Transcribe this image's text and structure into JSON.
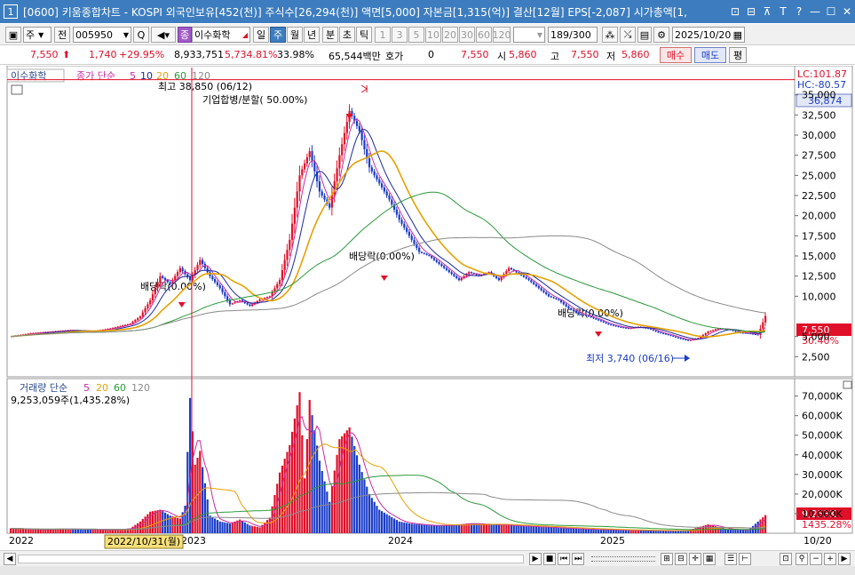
{
  "window": {
    "number": "1",
    "title": "[0600] 키움종합차트 - KOSPI 외국인보유[452(천)] 주식수[26,294(천)] 액면[5,000] 자본금[1,315(억)] 결산[12월] EPS[-2,087] 시가총액[1,",
    "icons": [
      "restore-icon",
      "tile-icon",
      "pin-icon",
      "text-icon",
      "help-icon",
      "minimize-icon",
      "maximize-icon",
      "close-icon"
    ],
    "icon_glyphs": [
      "⊡",
      "⊟",
      "⊼",
      "T",
      "?",
      "—",
      "☐",
      "✕"
    ]
  },
  "toolbar": {
    "period_select": "주",
    "prev_label": "전",
    "code": "005950",
    "search_glyph": "Q",
    "stock_badge": "종",
    "stock_name": "이수화학",
    "periods": [
      "일",
      "주",
      "월",
      "년",
      "분",
      "초",
      "틱"
    ],
    "active_period": "주",
    "intervals": [
      "1",
      "3",
      "5",
      "10",
      "20",
      "30",
      "60",
      "120"
    ],
    "count": "189",
    "count_total": "/300",
    "date": "2025/10/20"
  },
  "info": {
    "price": "7,550",
    "change": "1,740",
    "change_pct": "+29.95%",
    "volume": "8,933,751",
    "vol_pct": "5,734.81%",
    "turnover": "33.98%",
    "amount": "65,544백만",
    "bid_label": "호가",
    "bid_value": "0",
    "ask_price": "7,550",
    "open_label": "시",
    "open_value": "5,860",
    "high_label": "고",
    "high_value": "7,550",
    "low_label": "저",
    "low_value": "5,860",
    "buy_label": "매수",
    "sell_label": "매도",
    "flat_label": "평"
  },
  "price_panel": {
    "tag": "이수화학",
    "ma_title": "종가 단순",
    "ma_periods": [
      "5",
      "10",
      "20",
      "60",
      "120"
    ],
    "lc_label": "LC:101.87",
    "hc_label": "HC:-80.57",
    "top_value": "36,874",
    "current_label": "7,550",
    "current_pct": "30.40%",
    "high_annot": "최고 38,850 (06/12)",
    "merge_annot": "기업합병/분할( 50.00%)",
    "div_annot_1": "배당락(0.00%)",
    "div_annot_2": "배당락(0.00%)",
    "div_annot_3": "배당락(0.00%)",
    "low_annot": "최저 3,740 (06/16)",
    "y_ticks": [
      "35,000",
      "32,500",
      "30,000",
      "27,500",
      "25,000",
      "22,500",
      "20,000",
      "17,500",
      "15,000",
      "12,500",
      "10,000",
      "5,000",
      "2,500"
    ]
  },
  "volume_panel": {
    "title": "거래량 단순",
    "ma_periods": [
      "5",
      "20",
      "60",
      "120"
    ],
    "last_volume": "9,253,059주(1,435.28%)",
    "current_label": "9,253K",
    "current_pct": "1435.28%",
    "y_ticks": [
      "70,000K",
      "60,000K",
      "50,000K",
      "40,000K",
      "30,000K",
      "20,000K",
      "10,000K"
    ]
  },
  "x_axis": {
    "labels": [
      "2022",
      "2023",
      "2024",
      "2025"
    ],
    "cursor_label": "2022/10/31(월)",
    "right_label": "10/20"
  },
  "colors": {
    "up": "#e0102a",
    "down": "#1a3cc8",
    "ma5": "#cc2aa0",
    "ma10": "#1a2a9c",
    "ma20": "#e8a000",
    "ma60": "#2a9a3a",
    "ma120": "#8a8a8a",
    "titlebar": "#3d7dbf"
  },
  "chart_data": {
    "type": "candlestick",
    "interval": "weekly",
    "price_ylim": [
      0,
      37500
    ],
    "volume_ylim": [
      0,
      78000
    ],
    "volume_unit": "K",
    "moving_averages": [
      "5",
      "10",
      "20",
      "60",
      "120"
    ],
    "series": [
      {
        "name": "종가",
        "points": [
          [
            0,
            5000
          ],
          [
            8,
            5400
          ],
          [
            16,
            5600
          ],
          [
            24,
            5800
          ],
          [
            32,
            5600
          ],
          [
            40,
            6000
          ],
          [
            48,
            6600
          ],
          [
            52,
            7500
          ],
          [
            56,
            9500
          ],
          [
            60,
            12500
          ],
          [
            64,
            11500
          ],
          [
            68,
            13500
          ],
          [
            72,
            12000
          ],
          [
            76,
            14500
          ],
          [
            80,
            12500
          ],
          [
            84,
            11000
          ],
          [
            88,
            9000
          ],
          [
            92,
            9500
          ],
          [
            96,
            8800
          ],
          [
            100,
            9600
          ],
          [
            104,
            10000
          ],
          [
            108,
            12000
          ],
          [
            112,
            17000
          ],
          [
            116,
            25000
          ],
          [
            120,
            28000
          ],
          [
            124,
            23000
          ],
          [
            128,
            21000
          ],
          [
            132,
            27500
          ],
          [
            136,
            33000
          ],
          [
            140,
            30500
          ],
          [
            144,
            26000
          ],
          [
            148,
            24000
          ],
          [
            152,
            22000
          ],
          [
            156,
            19500
          ],
          [
            160,
            17500
          ],
          [
            164,
            15500
          ],
          [
            168,
            15000
          ],
          [
            172,
            14000
          ],
          [
            176,
            13000
          ],
          [
            180,
            12000
          ],
          [
            184,
            13000
          ],
          [
            188,
            12500
          ],
          [
            192,
            13000
          ],
          [
            196,
            12000
          ],
          [
            200,
            13500
          ],
          [
            204,
            12800
          ],
          [
            208,
            12000
          ],
          [
            212,
            11000
          ],
          [
            216,
            10000
          ],
          [
            220,
            9500
          ],
          [
            224,
            8500
          ],
          [
            228,
            7800
          ],
          [
            232,
            7500
          ],
          [
            236,
            7000
          ],
          [
            240,
            6500
          ],
          [
            244,
            6200
          ],
          [
            248,
            6000
          ],
          [
            252,
            6200
          ],
          [
            256,
            6000
          ],
          [
            260,
            5500
          ],
          [
            264,
            5200
          ],
          [
            268,
            4800
          ],
          [
            272,
            4500
          ],
          [
            276,
            4800
          ],
          [
            280,
            5600
          ],
          [
            284,
            6000
          ],
          [
            288,
            5900
          ],
          [
            292,
            5500
          ],
          [
            296,
            5400
          ],
          [
            300,
            5200
          ],
          [
            303,
            7550
          ]
        ]
      },
      {
        "name": "거래량",
        "points": [
          [
            0,
            2500
          ],
          [
            10,
            1800
          ],
          [
            20,
            2200
          ],
          [
            30,
            2000
          ],
          [
            40,
            1500
          ],
          [
            48,
            2500
          ],
          [
            52,
            6000
          ],
          [
            56,
            11000
          ],
          [
            60,
            12000
          ],
          [
            64,
            9000
          ],
          [
            68,
            7500
          ],
          [
            70,
            14000
          ],
          [
            72,
            69000
          ],
          [
            74,
            35000
          ],
          [
            76,
            42000
          ],
          [
            80,
            9000
          ],
          [
            84,
            6000
          ],
          [
            88,
            5000
          ],
          [
            92,
            7000
          ],
          [
            96,
            4000
          ],
          [
            100,
            3000
          ],
          [
            104,
            8000
          ],
          [
            108,
            31000
          ],
          [
            112,
            45000
          ],
          [
            116,
            72000
          ],
          [
            118,
            28000
          ],
          [
            120,
            68000
          ],
          [
            124,
            37000
          ],
          [
            128,
            16000
          ],
          [
            132,
            48000
          ],
          [
            136,
            54000
          ],
          [
            140,
            35000
          ],
          [
            144,
            20000
          ],
          [
            148,
            12000
          ],
          [
            152,
            9000
          ],
          [
            156,
            6000
          ],
          [
            160,
            5000
          ],
          [
            168,
            4000
          ],
          [
            176,
            4000
          ],
          [
            184,
            5000
          ],
          [
            192,
            4500
          ],
          [
            200,
            4000
          ],
          [
            208,
            3500
          ],
          [
            216,
            3000
          ],
          [
            224,
            2500
          ],
          [
            232,
            2000
          ],
          [
            240,
            1800
          ],
          [
            248,
            1500
          ],
          [
            256,
            1400
          ],
          [
            264,
            1200
          ],
          [
            272,
            1500
          ],
          [
            280,
            4500
          ],
          [
            288,
            2000
          ],
          [
            296,
            1500
          ],
          [
            303,
            9253
          ]
        ]
      }
    ]
  }
}
